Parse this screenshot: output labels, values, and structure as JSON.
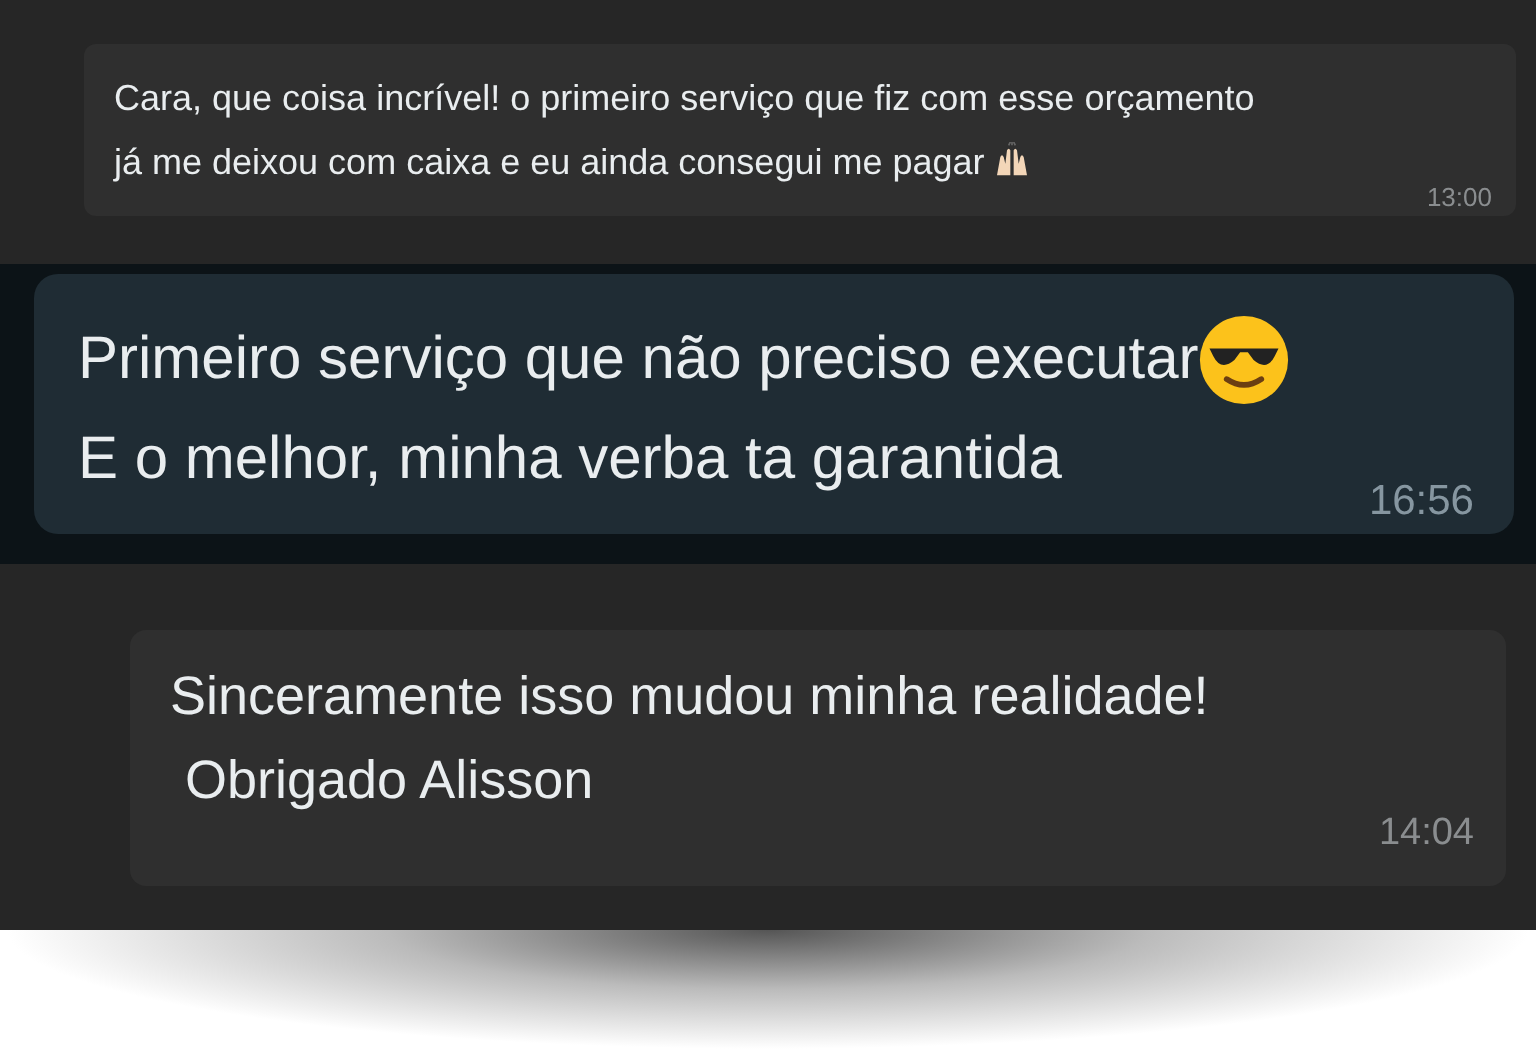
{
  "messages": [
    {
      "kind": "hands",
      "color": "#2f2f2f",
      "lines": [
        "Cara, que coisa incrível! o primeiro serviço que fiz com esse orçamento",
        "já me deixou com caixa e eu ainda consegui me pagar"
      ],
      "time": "13:00"
    },
    {
      "kind": "sunglasses",
      "color": "#1f2c34",
      "lines": [
        "Primeiro serviço que não preciso executar",
        "E o melhor, minha verba ta garantida"
      ],
      "time": "16:56"
    },
    {
      "kind": "text",
      "color": "#2f2f2f",
      "lines": [
        "Sinceramente isso mudou minha realidade!",
        " Obrigado Alisson"
      ],
      "time": "14:04"
    }
  ]
}
